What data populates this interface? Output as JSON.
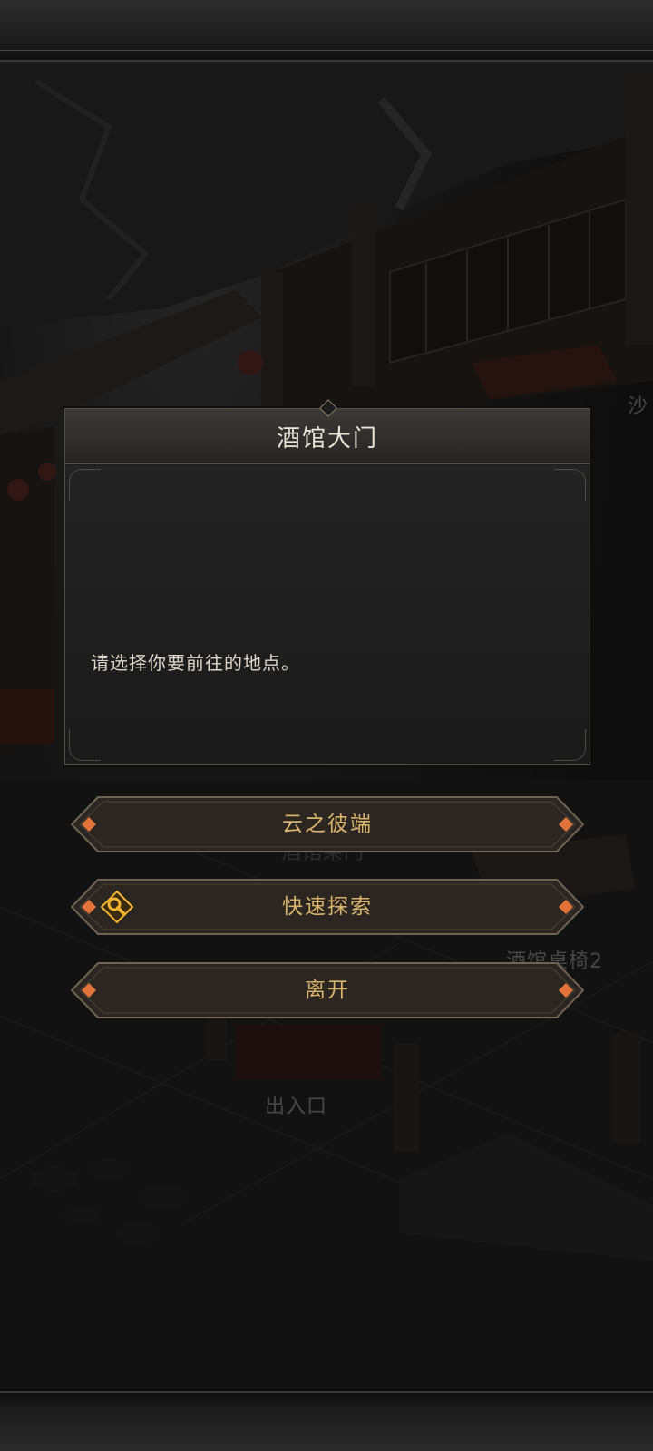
{
  "scene": {
    "labels": [
      "沙",
      "酒馆桌椅2",
      "出入口",
      "酒馆柴门"
    ]
  },
  "dialog": {
    "title": "酒馆大门",
    "message": "请选择你要前往的地点。"
  },
  "options": [
    {
      "label": "云之彼端",
      "icon": null
    },
    {
      "label": "快速探索",
      "icon": "magnifier-icon"
    },
    {
      "label": "离开",
      "icon": null
    }
  ],
  "colors": {
    "option_text": "#d9b36a",
    "option_gem": "#e0743a",
    "icon_gold": "#f2b531"
  }
}
